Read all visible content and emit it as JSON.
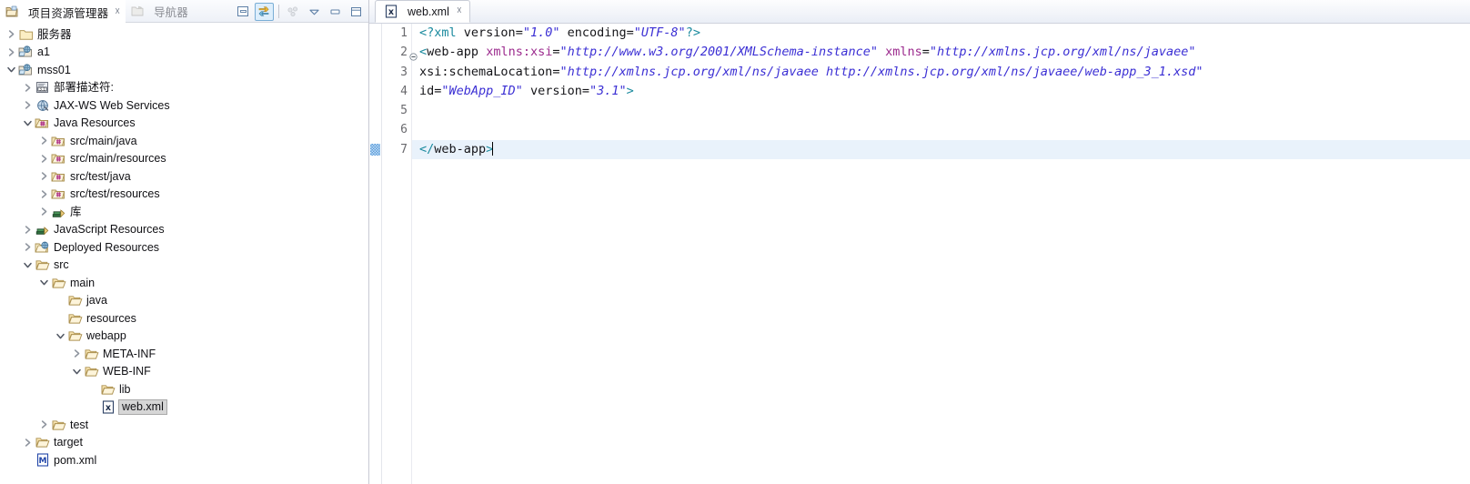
{
  "left_panel": {
    "tabs": [
      {
        "label": "项目资源管理器",
        "icon": "project-explorer-icon",
        "active": true,
        "closable": true
      },
      {
        "label": "导航器",
        "icon": "navigator-icon",
        "active": false,
        "closable": false
      }
    ],
    "toolbar": [
      {
        "name": "collapse-all-button",
        "label": "Collapse All",
        "active": false
      },
      {
        "name": "link-with-editor-button",
        "label": "Link with Editor",
        "active": true
      },
      {
        "name": "view-menu-button",
        "label": "View Menu",
        "active": false
      },
      {
        "name": "view-chevron-button",
        "label": "View Menu Chevron",
        "active": false
      },
      {
        "name": "minimize-button",
        "label": "Minimize",
        "active": false
      },
      {
        "name": "maximize-button",
        "label": "Maximize",
        "active": false
      }
    ],
    "tree": [
      {
        "label": "服务器",
        "depth": 0,
        "icon": "folder-closed-icon",
        "twisty": "collapsed"
      },
      {
        "label": "a1",
        "depth": 0,
        "icon": "web-project-icon",
        "twisty": "collapsed"
      },
      {
        "label": "mss01",
        "depth": 0,
        "icon": "web-project-icon",
        "twisty": "expanded"
      },
      {
        "label": "部署描述符:",
        "depth": 1,
        "icon": "deployment-descriptor-icon",
        "twisty": "collapsed"
      },
      {
        "label": "JAX-WS Web Services",
        "depth": 1,
        "icon": "jaxws-icon",
        "twisty": "collapsed"
      },
      {
        "label": "Java Resources",
        "depth": 1,
        "icon": "java-resources-icon",
        "twisty": "expanded"
      },
      {
        "label": "src/main/java",
        "depth": 2,
        "icon": "source-folder-icon",
        "twisty": "collapsed"
      },
      {
        "label": "src/main/resources",
        "depth": 2,
        "icon": "source-folder-icon",
        "twisty": "collapsed"
      },
      {
        "label": "src/test/java",
        "depth": 2,
        "icon": "source-folder-icon",
        "twisty": "collapsed"
      },
      {
        "label": "src/test/resources",
        "depth": 2,
        "icon": "source-folder-icon",
        "twisty": "collapsed"
      },
      {
        "label": "库",
        "depth": 2,
        "icon": "library-icon",
        "twisty": "collapsed"
      },
      {
        "label": "JavaScript Resources",
        "depth": 1,
        "icon": "library-icon",
        "twisty": "collapsed"
      },
      {
        "label": "Deployed Resources",
        "depth": 1,
        "icon": "deployed-resources-icon",
        "twisty": "collapsed"
      },
      {
        "label": "src",
        "depth": 1,
        "icon": "folder-open-icon",
        "twisty": "expanded"
      },
      {
        "label": "main",
        "depth": 2,
        "icon": "folder-open-icon",
        "twisty": "expanded"
      },
      {
        "label": "java",
        "depth": 3,
        "icon": "folder-open-icon",
        "twisty": "none"
      },
      {
        "label": "resources",
        "depth": 3,
        "icon": "folder-open-icon",
        "twisty": "none"
      },
      {
        "label": "webapp",
        "depth": 3,
        "icon": "folder-open-icon",
        "twisty": "expanded"
      },
      {
        "label": "META-INF",
        "depth": 4,
        "icon": "folder-open-icon",
        "twisty": "collapsed"
      },
      {
        "label": "WEB-INF",
        "depth": 4,
        "icon": "folder-open-icon",
        "twisty": "expanded"
      },
      {
        "label": "lib",
        "depth": 5,
        "icon": "folder-open-icon",
        "twisty": "none"
      },
      {
        "label": "web.xml",
        "depth": 5,
        "icon": "xml-file-icon",
        "twisty": "none",
        "selected": true
      },
      {
        "label": "test",
        "depth": 2,
        "icon": "folder-open-icon",
        "twisty": "collapsed"
      },
      {
        "label": "target",
        "depth": 1,
        "icon": "folder-open-icon",
        "twisty": "collapsed"
      },
      {
        "label": "pom.xml",
        "depth": 1,
        "icon": "maven-file-icon",
        "twisty": "none"
      }
    ]
  },
  "editor": {
    "tab": {
      "label": "web.xml",
      "icon": "xml-file-icon",
      "closable": true
    },
    "current_line": 7,
    "lines": [
      {
        "number": "1",
        "folding": "none",
        "tokens": [
          {
            "t": "<?xml ",
            "c": "k-tag"
          },
          {
            "t": "version",
            "c": "k-attr2"
          },
          {
            "t": "=",
            "c": "k-eq"
          },
          {
            "t": "\"1.0\"",
            "c": "k-val"
          },
          {
            "t": " ",
            "c": "k-eq"
          },
          {
            "t": "encoding",
            "c": "k-attr2"
          },
          {
            "t": "=",
            "c": "k-eq"
          },
          {
            "t": "\"UTF-8\"",
            "c": "k-val"
          },
          {
            "t": "?>",
            "c": "k-tag"
          }
        ]
      },
      {
        "number": "2",
        "folding": "collapse",
        "tokens": [
          {
            "t": "<",
            "c": "k-tag"
          },
          {
            "t": "web-app",
            "c": "k-name"
          },
          {
            "t": " ",
            "c": "k-eq"
          },
          {
            "t": "xmlns:xsi",
            "c": "k-attr"
          },
          {
            "t": "=",
            "c": "k-eq"
          },
          {
            "t": "\"http://www.w3.org/2001/XMLSchema-instance\"",
            "c": "k-val"
          },
          {
            "t": " ",
            "c": "k-eq"
          },
          {
            "t": "xmlns",
            "c": "k-attr"
          },
          {
            "t": "=",
            "c": "k-eq"
          },
          {
            "t": "\"http://xmlns.jcp.org/xml/ns/javaee\"",
            "c": "k-val"
          }
        ]
      },
      {
        "number": "3",
        "folding": "none",
        "tokens": [
          {
            "t": "xsi:schemaLocation",
            "c": "k-attr2"
          },
          {
            "t": "=",
            "c": "k-eq"
          },
          {
            "t": "\"http://xmlns.jcp.org/xml/ns/javaee http://xmlns.jcp.org/xml/ns/javaee/web-app_3_1.xsd\"",
            "c": "k-val"
          }
        ]
      },
      {
        "number": "4",
        "folding": "none",
        "tokens": [
          {
            "t": "id",
            "c": "k-attr2"
          },
          {
            "t": "=",
            "c": "k-eq"
          },
          {
            "t": "\"WebApp_ID\"",
            "c": "k-val"
          },
          {
            "t": " ",
            "c": "k-eq"
          },
          {
            "t": "version",
            "c": "k-attr2"
          },
          {
            "t": "=",
            "c": "k-eq"
          },
          {
            "t": "\"3.1\"",
            "c": "k-val"
          },
          {
            "t": ">",
            "c": "k-tag"
          }
        ]
      },
      {
        "number": "5",
        "folding": "none",
        "tokens": []
      },
      {
        "number": "6",
        "folding": "none",
        "tokens": []
      },
      {
        "number": "7",
        "folding": "none",
        "current": true,
        "tokens": [
          {
            "t": "</",
            "c": "k-tag"
          },
          {
            "t": "web-app",
            "c": "k-name"
          },
          {
            "t": ">",
            "c": "k-tag"
          }
        ]
      }
    ]
  },
  "colors": {
    "tag": "#1a8a9e",
    "attribute": "#9c2b8e",
    "value": "#3b2fd4",
    "selection": "#d6d6d6",
    "current_line": "#e9f2fb",
    "toolbar_active": "#ddeefc"
  }
}
